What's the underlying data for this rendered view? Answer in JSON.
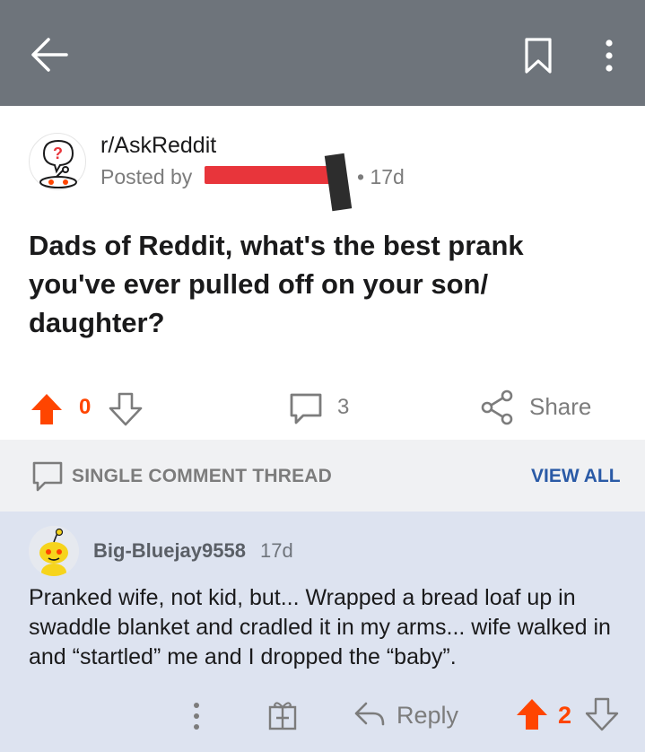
{
  "topbar": {
    "icons": {
      "back": "back-arrow-icon",
      "bookmark": "bookmark-icon",
      "more": "more-vertical-icon"
    },
    "background": "#6e747b"
  },
  "post": {
    "subreddit": "r/AskReddit",
    "posted_by_prefix": "Posted by",
    "age": "• 17d",
    "title": "Dads of Reddit, what's the best prank you've ever pulled off on your son/ daughter?",
    "vote_count": "0",
    "comment_count": "3",
    "share_label": "Share"
  },
  "thread": {
    "label": "SINGLE COMMENT THREAD",
    "view_all": "VIEW ALL"
  },
  "comment": {
    "username": "Big-Bluejay9558",
    "age": "17d",
    "body": "Pranked wife, not kid, but... Wrapped a bread loaf up in swaddle blanket and cradled it in my arms... wife walked in and “startled” me and I dropped the “baby”.",
    "reply_label": "Reply",
    "score": "2"
  },
  "colors": {
    "upvote": "#ff4500",
    "link": "#2a5aa6",
    "comment_bg": "#dde3f0"
  }
}
